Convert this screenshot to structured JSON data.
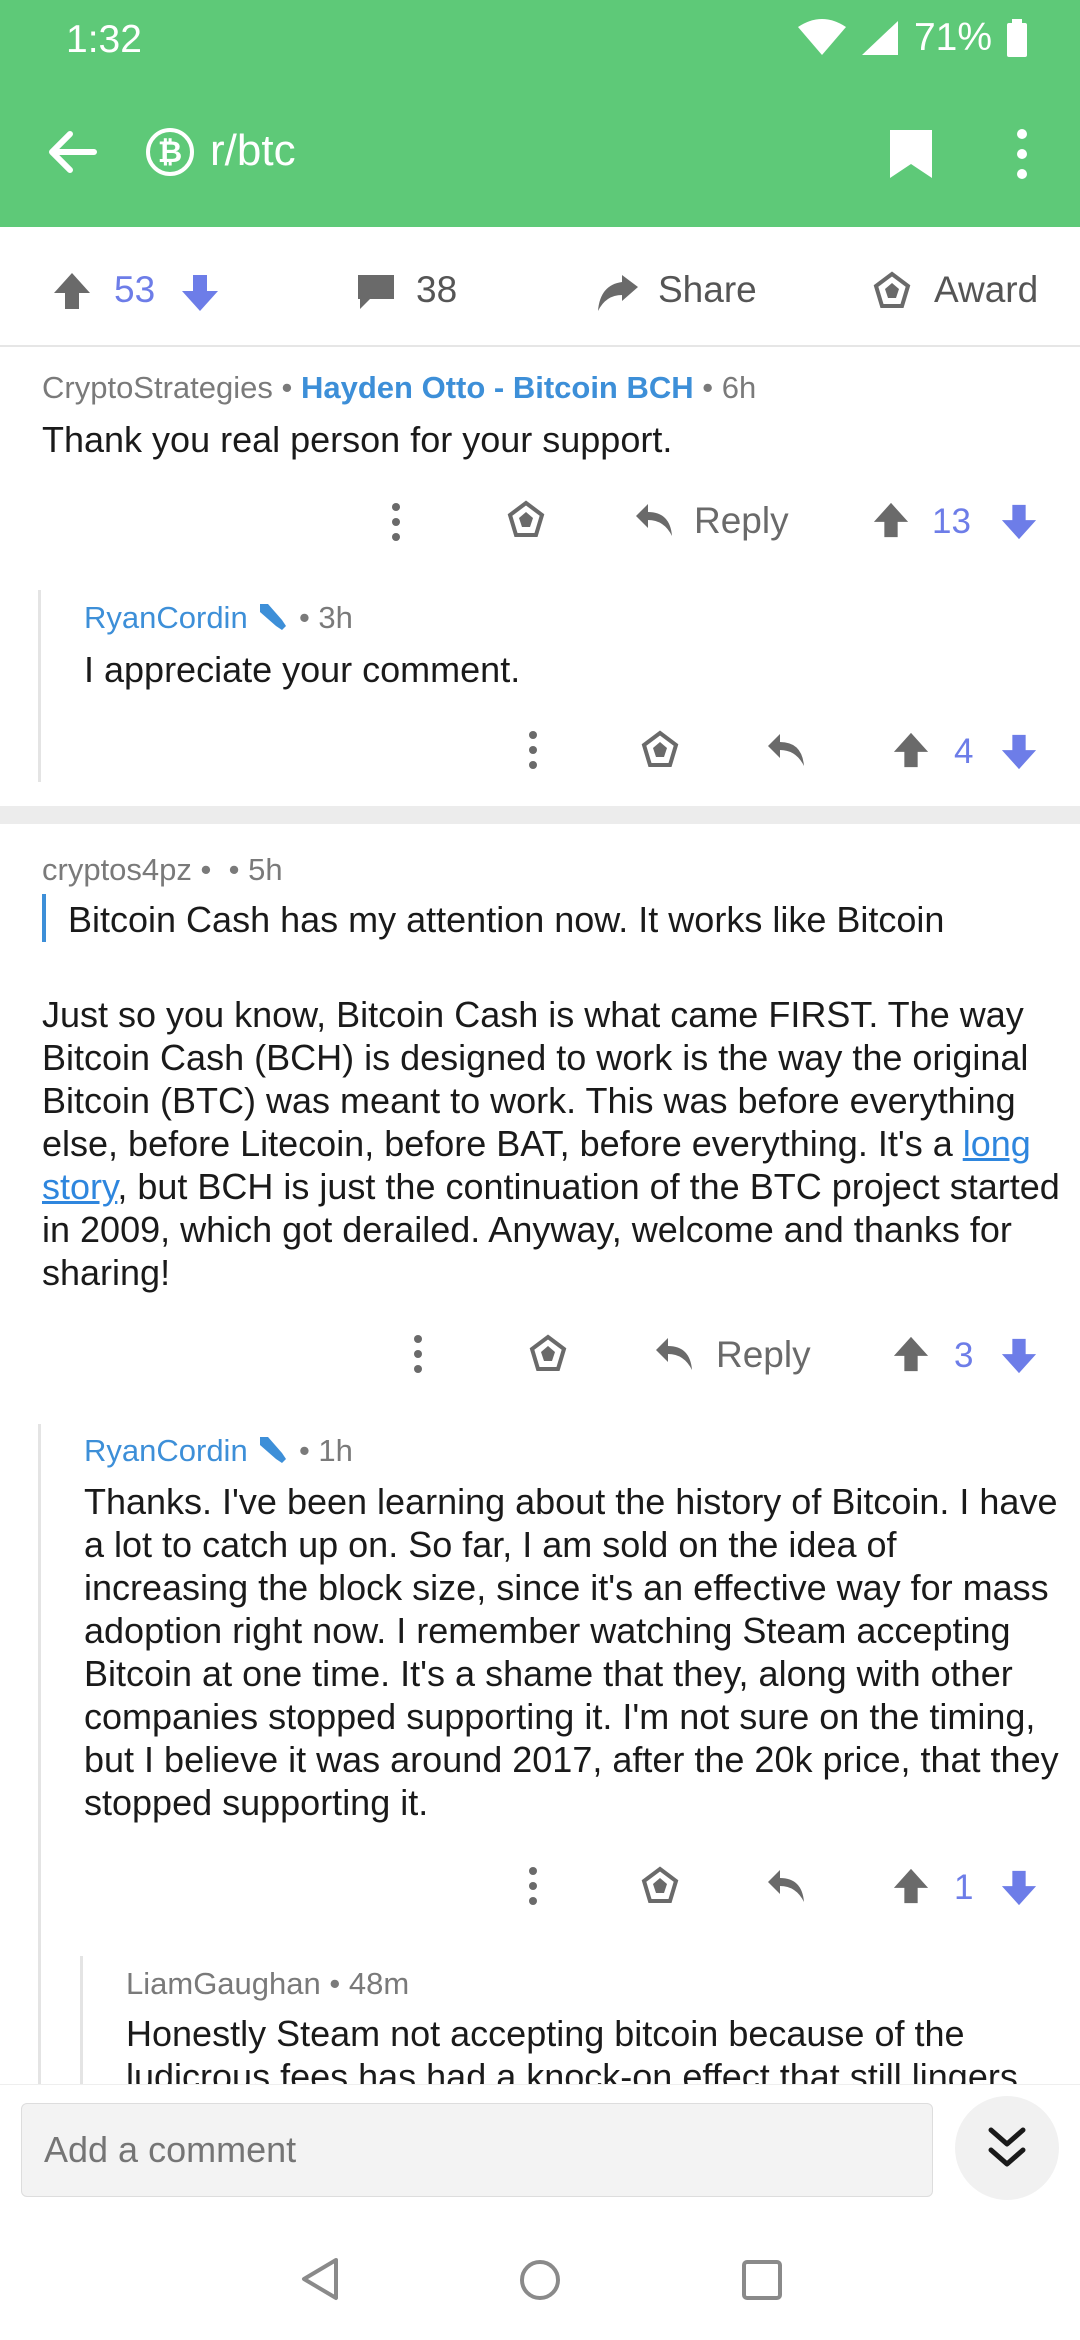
{
  "status": {
    "time": "1:32",
    "battery": "71%"
  },
  "appbar": {
    "subreddit": "r/btc",
    "sub_icon_glyph": "₿"
  },
  "actions": {
    "upvotes": "53",
    "comments": "38",
    "share": "Share",
    "award": "Award"
  },
  "comments": [
    {
      "author": "CryptoStrategies",
      "flair": "Hayden Otto - Bitcoin BCH",
      "time": "6h",
      "body": "Thank you real person for your support.",
      "reply": "Reply",
      "score": "13"
    },
    {
      "author": "RyanCordin",
      "time": "3h",
      "body": "I appreciate your comment.",
      "score": "4"
    },
    {
      "author": "cryptos4pz",
      "time": "5h",
      "quote": "Bitcoin Cash has my attention now. It works like Bitcoin",
      "body_pre": "Just so you know, Bitcoin Cash is what came FIRST. The way Bitcoin Cash (BCH) is designed to work is the way the original Bitcoin (BTC) was meant to work. This was before everything else, before Litecoin, before BAT, before everything. It's a ",
      "link": "long story",
      "body_post": ", but BCH is just the continuation of the BTC project started in 2009, which got derailed. Anyway, welcome and thanks for sharing!",
      "reply": "Reply",
      "score": "3"
    },
    {
      "author": "RyanCordin",
      "time": "1h",
      "body": "Thanks. I've been learning about the history of Bitcoin. I have a lot to catch up on. So far, I am sold on the idea of increasing the block size, since it's an effective way for mass adoption right now. I remember watching Steam accepting Bitcoin at one time. It's a shame that they, along with other companies stopped supporting it. I'm not sure on the timing, but I believe it was around 2017, after the 20k price, that they stopped supporting it.",
      "score": "1"
    },
    {
      "author": "LiamGaughan",
      "time": "48m",
      "body": "Honestly Steam not accepting bitcoin because of the ludicrous fees has had a knock-on effect that still lingers"
    }
  ],
  "bottom": {
    "placeholder": "Add a comment"
  },
  "colors": {
    "header": "#5ec978",
    "vote": "#6d7de8",
    "link": "#3d8fd8"
  }
}
